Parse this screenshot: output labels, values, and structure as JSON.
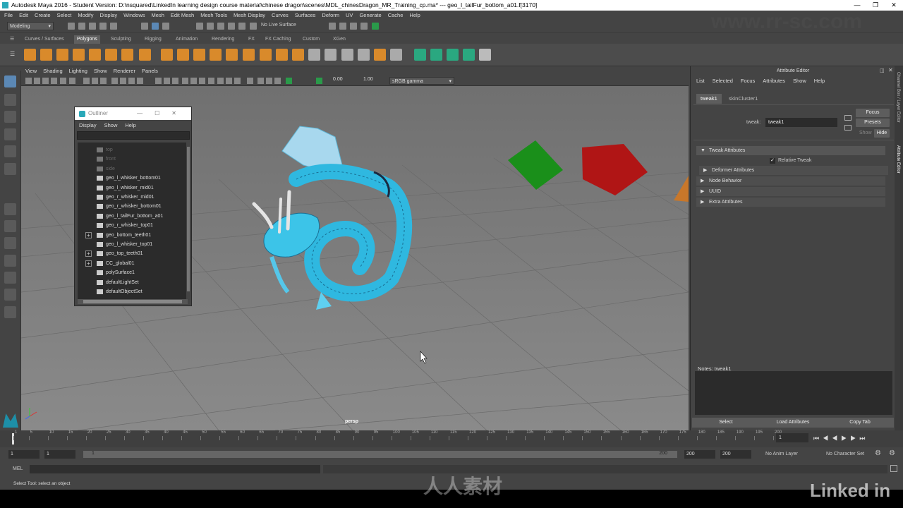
{
  "window": {
    "title": "Autodesk Maya 2016 - Student Version: D:\\nsquared\\LinkedIn learning design course material\\chinese dragon\\scenes\\MDL_chinesDragon_MR_Training_cp.ma*   ---   geo_l_tailFur_bottom_a01.f[3170]"
  },
  "menubar": [
    "File",
    "Edit",
    "Create",
    "Select",
    "Modify",
    "Display",
    "Windows",
    "Mesh",
    "Edit Mesh",
    "Mesh Tools",
    "Mesh Display",
    "Curves",
    "Surfaces",
    "Deform",
    "UV",
    "Generate",
    "Cache",
    "Help"
  ],
  "status_line": {
    "mode": "Modeling",
    "live_surface": "No Live Surface"
  },
  "shelf_tabs": [
    "Curves / Surfaces",
    "Polygons",
    "Sculpting",
    "Rigging",
    "Animation",
    "Rendering",
    "FX",
    "FX Caching",
    "Custom",
    "XGen"
  ],
  "active_shelf_tab": "Polygons",
  "viewport": {
    "menu": [
      "View",
      "Shading",
      "Lighting",
      "Show",
      "Renderer",
      "Panels"
    ],
    "exposure": "0.00",
    "gamma": "1.00",
    "color_space": "sRGB gamma",
    "camera_label": "persp"
  },
  "outliner": {
    "title": "Outliner",
    "menu": [
      "Display",
      "Show",
      "Help"
    ],
    "items": [
      {
        "label": "top",
        "dim": true,
        "expand": false
      },
      {
        "label": "front",
        "dim": true,
        "expand": false
      },
      {
        "label": "side",
        "dim": true,
        "expand": false
      },
      {
        "label": "geo_l_whisker_bottom01",
        "dim": false,
        "expand": false
      },
      {
        "label": "geo_l_whisker_mid01",
        "dim": false,
        "expand": false
      },
      {
        "label": "geo_r_whisker_mid01",
        "dim": false,
        "expand": false
      },
      {
        "label": "geo_r_whisker_bottom01",
        "dim": false,
        "expand": false
      },
      {
        "label": "geo_l_tailFur_bottom_a01",
        "dim": false,
        "expand": false
      },
      {
        "label": "geo_r_whisker_top01",
        "dim": false,
        "expand": false
      },
      {
        "label": "geo_bottom_teeth01",
        "dim": false,
        "expand": true
      },
      {
        "label": "geo_l_whisker_top01",
        "dim": false,
        "expand": false
      },
      {
        "label": "geo_top_teeth01",
        "dim": false,
        "expand": true
      },
      {
        "label": "CC_global01",
        "dim": false,
        "expand": true
      },
      {
        "label": "polySurface1",
        "dim": false,
        "expand": false
      },
      {
        "label": "defaultLightSet",
        "dim": false,
        "expand": false
      },
      {
        "label": "defaultObjectSet",
        "dim": false,
        "expand": false
      }
    ]
  },
  "attribute_editor": {
    "title": "Attribute Editor",
    "menu": [
      "List",
      "Selected",
      "Focus",
      "Attributes",
      "Show",
      "Help"
    ],
    "tabs": [
      "tweak1",
      "skinCluster1"
    ],
    "node_label": "tweak:",
    "node_value": "tweak1",
    "focus_btn": "Focus",
    "presets_btn": "Presets",
    "show_btn": "Show",
    "hide_btn": "Hide",
    "sections": [
      {
        "label": "Tweak Attributes",
        "open": true
      },
      {
        "label": "Deformer Attributes",
        "open": false
      },
      {
        "label": "Node Behavior",
        "open": false
      },
      {
        "label": "UUID",
        "open": false
      },
      {
        "label": "Extra Attributes",
        "open": false
      }
    ],
    "relative_tweak": "Relative Tweak",
    "notes_label": "Notes:  tweak1",
    "buttons": [
      "Select",
      "Load Attributes",
      "Copy Tab"
    ],
    "side_tabs": [
      "Channel Box / Layer Editor",
      "Attribute Editor"
    ]
  },
  "timeline": {
    "ticks": [
      "1",
      "5",
      "10",
      "15",
      "20",
      "25",
      "30",
      "35",
      "40",
      "45",
      "50",
      "55",
      "60",
      "65",
      "70",
      "75",
      "80",
      "85",
      "90",
      "95",
      "100",
      "105",
      "110",
      "115",
      "120",
      "125",
      "130",
      "135",
      "140",
      "145",
      "150",
      "155",
      "160",
      "165",
      "170",
      "175",
      "180",
      "185",
      "190",
      "195",
      "200"
    ],
    "current_frame": "1"
  },
  "range": {
    "start": "1",
    "start2": "1",
    "slider_start": "1",
    "slider_end": "200",
    "end": "200",
    "end2": "200",
    "anim_layer": "No Anim Layer",
    "character_set": "No Character Set"
  },
  "mel_label": "MEL",
  "help_line": "Select Tool: select an object",
  "overlays": {
    "site": "www.rr-sc.com",
    "brand": "Linked in",
    "cn_brand": "人人素材"
  },
  "colors": {
    "viewport_bg": "#7d7d7d",
    "dragon": "#3cc4e8",
    "green_box": "#1a8f1a",
    "red_box": "#b01515"
  }
}
